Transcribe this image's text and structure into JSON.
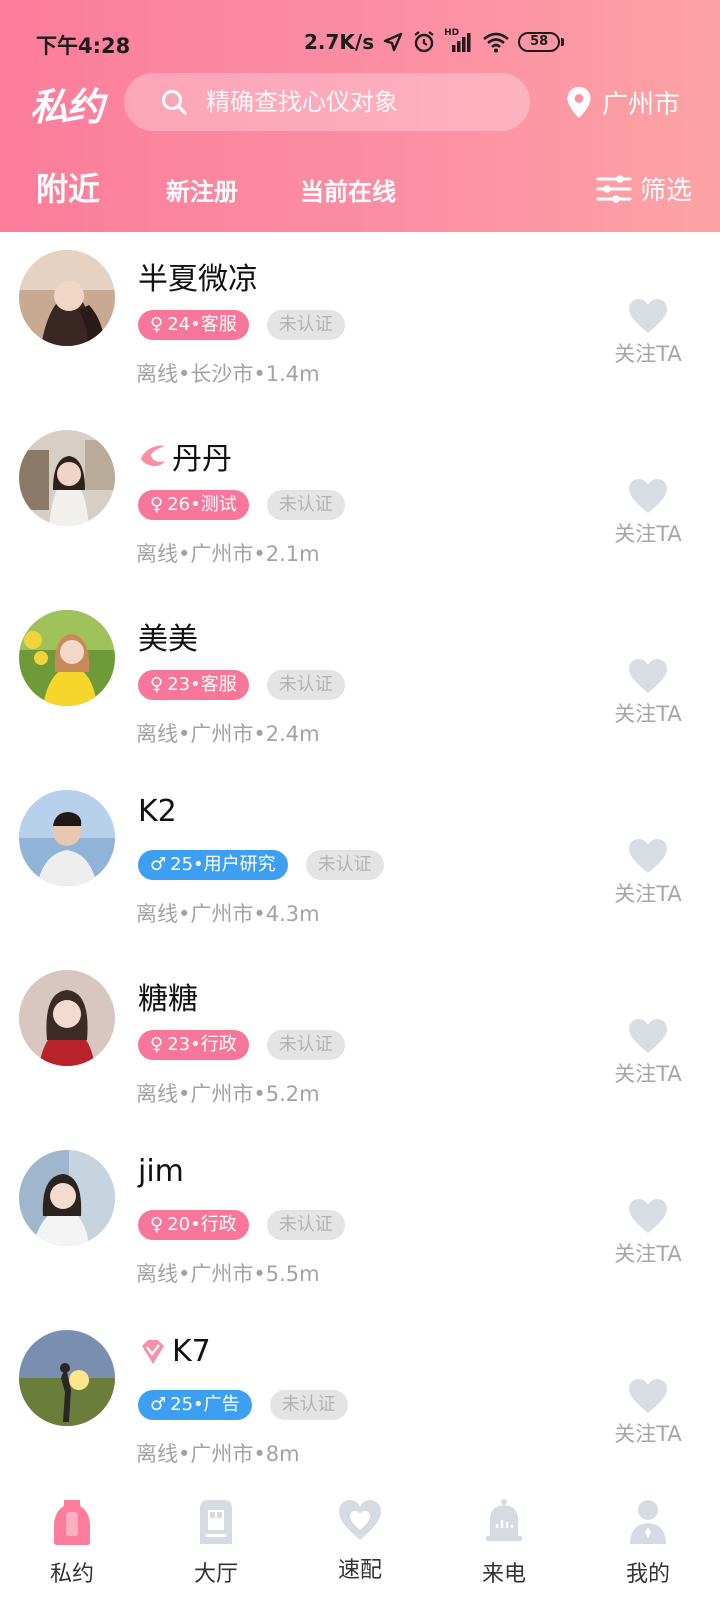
{
  "status_bar": {
    "time": "下午4:28",
    "network_speed": "2.7K/s",
    "hd_label": "HD",
    "battery": "58"
  },
  "header": {
    "logo": "私约",
    "search_placeholder": "精确查找心仪对象",
    "city": "广州市",
    "tabs": [
      {
        "label": "附近",
        "active": true
      },
      {
        "label": "新注册",
        "active": false
      },
      {
        "label": "当前在线",
        "active": false
      }
    ],
    "filter_label": "筛选"
  },
  "users": [
    {
      "name": "半夏微凉",
      "gender": "female",
      "gender_symbol": "♀",
      "tag": "24•客服",
      "verify": "未认证",
      "meta": "离线•长沙市•1.4m",
      "follow": "关注TA",
      "vip": false
    },
    {
      "name": "丹丹",
      "gender": "female",
      "gender_symbol": "♀",
      "tag": "26•测试",
      "verify": "未认证",
      "meta": "离线•广州市•2.1m",
      "follow": "关注TA",
      "vip": true
    },
    {
      "name": "美美",
      "gender": "female",
      "gender_symbol": "♀",
      "tag": "23•客服",
      "verify": "未认证",
      "meta": "离线•广州市•2.4m",
      "follow": "关注TA",
      "vip": false
    },
    {
      "name": "K2",
      "gender": "male",
      "gender_symbol": "♂",
      "tag": "25•用户研究",
      "verify": "未认证",
      "meta": "离线•广州市•4.3m",
      "follow": "关注TA",
      "vip": false
    },
    {
      "name": "糖糖",
      "gender": "female",
      "gender_symbol": "♀",
      "tag": "23•行政",
      "verify": "未认证",
      "meta": "离线•广州市•5.2m",
      "follow": "关注TA",
      "vip": false
    },
    {
      "name": "jim",
      "gender": "female",
      "gender_symbol": "♀",
      "tag": "20•行政",
      "verify": "未认证",
      "meta": "离线•广州市•5.5m",
      "follow": "关注TA",
      "vip": false
    },
    {
      "name": "K7",
      "gender": "male",
      "gender_symbol": "♂",
      "tag": "25•广告",
      "verify": "未认证",
      "meta": "离线•广州市•8m",
      "follow": "关注TA",
      "vip": true
    }
  ],
  "bottom_nav": [
    {
      "label": "私约",
      "icon": "shield-icon",
      "active": true
    },
    {
      "label": "大厅",
      "icon": "hall-icon",
      "active": false
    },
    {
      "label": "速配",
      "icon": "heart-icon",
      "active": false
    },
    {
      "label": "来电",
      "icon": "bell-icon",
      "active": false
    },
    {
      "label": "我的",
      "icon": "person-icon",
      "active": false
    }
  ],
  "colors": {
    "accent": "#fc7d9b",
    "female_tag": "#f7769a",
    "male_tag": "#3d9ff1",
    "follow_heart": "#d8dde3",
    "nav_inactive": "#d6dbe2"
  }
}
